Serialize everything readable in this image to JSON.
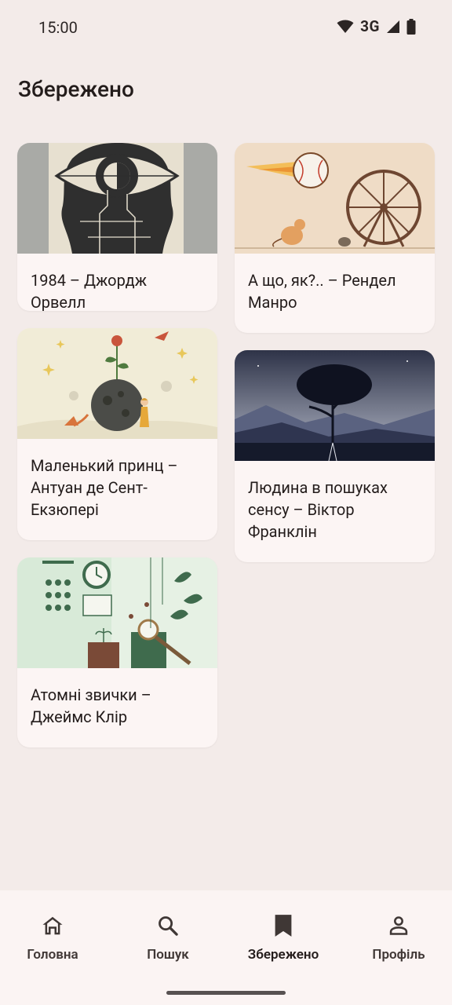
{
  "status": {
    "time": "15:00",
    "network": "3G"
  },
  "page": {
    "title": "Збережено"
  },
  "books": [
    {
      "caption": "1984 – Джордж Орвелл"
    },
    {
      "caption": "А що, як?.. – Рендел Манро"
    },
    {
      "caption": "Маленький принц – Антуан де Сент-Екзюпері"
    },
    {
      "caption": "Людина в пошуках сенсу – Віктор Франклін"
    },
    {
      "caption": "Атомні звички – Джеймс Клір"
    }
  ],
  "nav": [
    {
      "label": "Головна",
      "icon": "home-icon"
    },
    {
      "label": "Пошук",
      "icon": "search-icon"
    },
    {
      "label": "Збережено",
      "icon": "bookmark-icon"
    },
    {
      "label": "Профіль",
      "icon": "person-icon"
    }
  ]
}
